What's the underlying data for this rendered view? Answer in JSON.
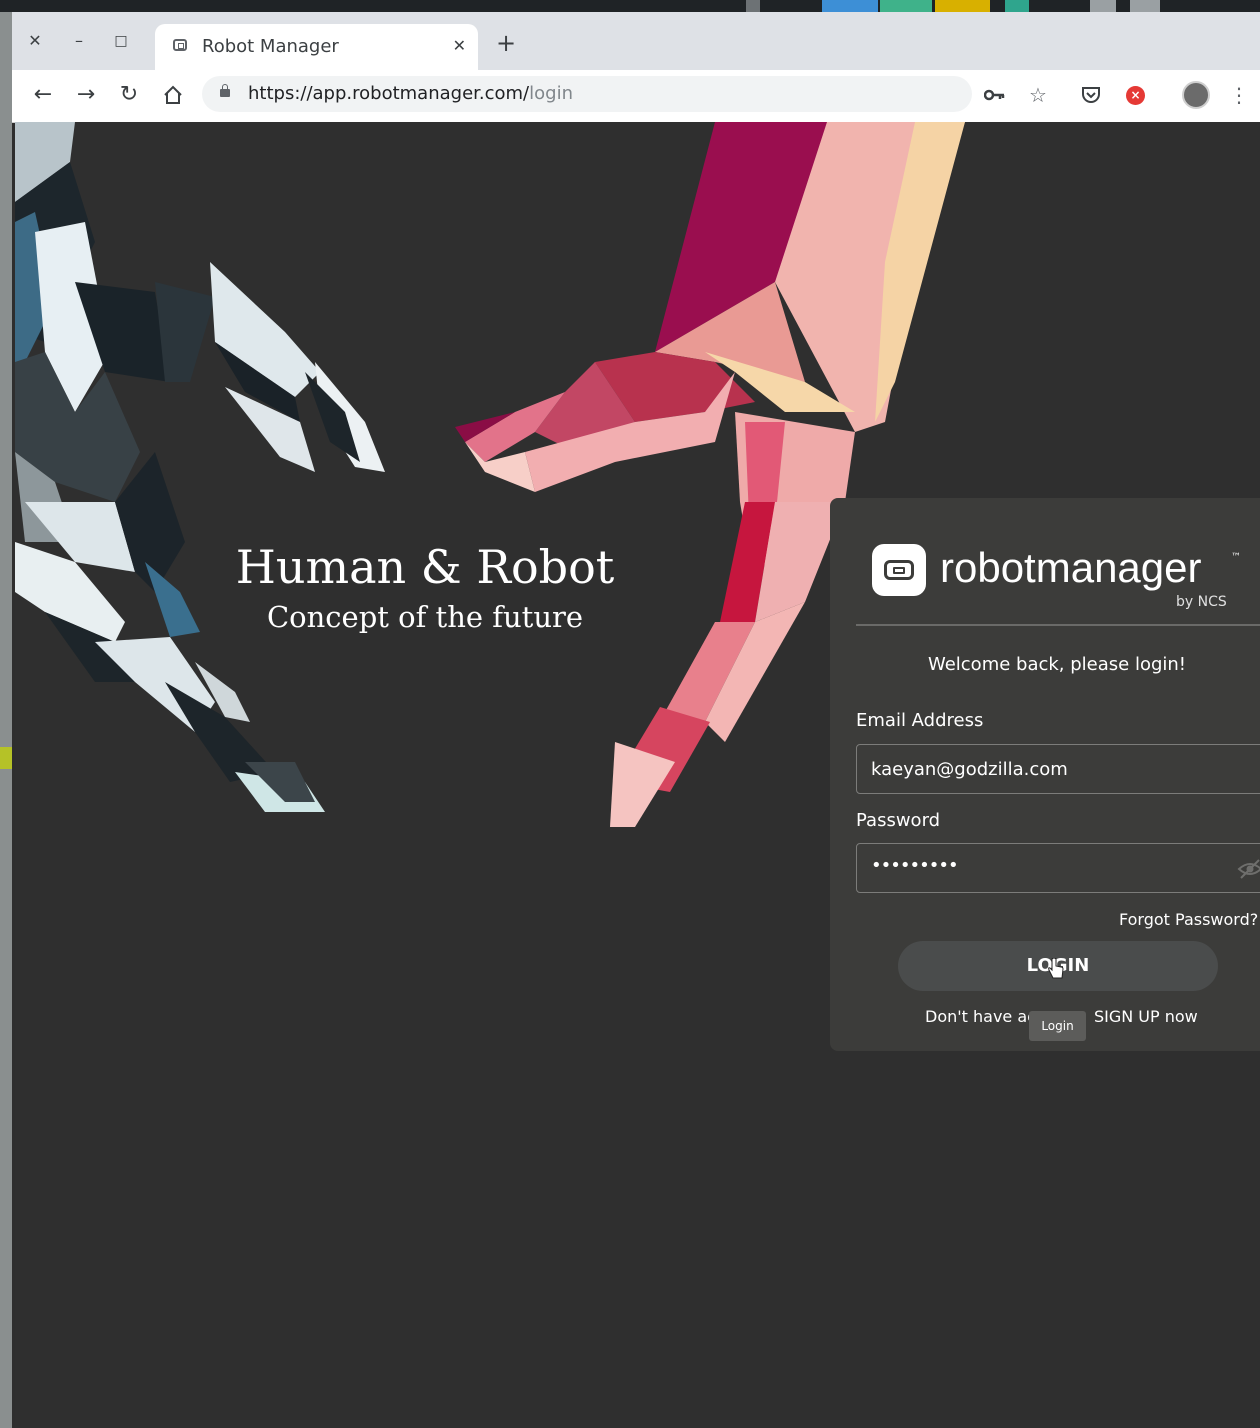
{
  "colors": {
    "page_bg": "#2f2f2f",
    "panel_bg": "#3c3c3a",
    "accent_red": "#e53935"
  },
  "browser": {
    "window_buttons": [
      "close",
      "minimize",
      "maximize"
    ],
    "tab": {
      "title": "Robot Manager",
      "close_icon": "close-icon"
    },
    "address_bar": {
      "host": "https://app.robotmanager.com/",
      "path": "login"
    },
    "icons": [
      "back-arrow-icon",
      "forward-arrow-icon",
      "reload-icon",
      "home-icon",
      "lock-icon",
      "key-icon",
      "star-icon",
      "pocket-icon",
      "stop-icon",
      "profile-avatar",
      "menu-icon"
    ]
  },
  "hero": {
    "title": "Human & Robot",
    "subtitle": "Concept of the future"
  },
  "login": {
    "brand": "robotmanager",
    "trademark": "™",
    "byline": "by NCS",
    "welcome": "Welcome back, please login!",
    "email_label": "Email Address",
    "email_value": "kaeyan@godzilla.com",
    "password_label": "Password",
    "password_value": "•••••••••",
    "forgot": "Forgot Password?",
    "button": "LOGIN",
    "signup_prefix": "Don't have ac",
    "signup_link": "SIGN UP now",
    "tooltip": "Login"
  }
}
